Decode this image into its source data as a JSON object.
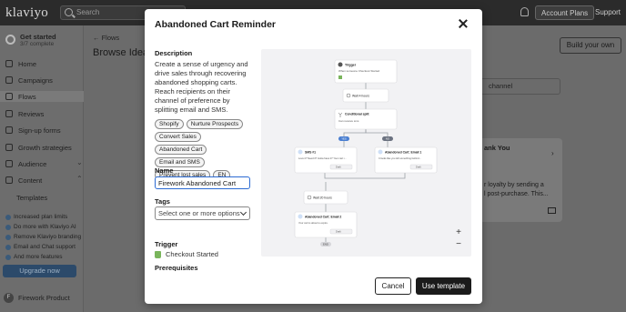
{
  "topbar": {
    "logo": "klaviyo",
    "search_placeholder": "Search",
    "account_plans": "Account Plans",
    "support": "Support"
  },
  "sidebar": {
    "getting_started": {
      "title": "Get started",
      "subtitle": "3/7 complete"
    },
    "items": [
      {
        "label": "Home",
        "icon": "home-icon"
      },
      {
        "label": "Campaigns",
        "icon": "megaphone-icon"
      },
      {
        "label": "Flows",
        "icon": "flow-icon",
        "active": true
      },
      {
        "label": "Reviews",
        "icon": "star-icon"
      },
      {
        "label": "Sign-up forms",
        "icon": "form-icon"
      },
      {
        "label": "Growth strategies",
        "icon": "growth-icon"
      },
      {
        "label": "Audience",
        "icon": "people-icon"
      },
      {
        "label": "Content",
        "icon": "content-icon"
      },
      {
        "label": "Templates",
        "icon": ""
      }
    ],
    "promos": [
      "Increased plan limits",
      "Do more with Klaviyo AI",
      "Remove Klaviyo branding",
      "Email and Chat support",
      "And more features"
    ],
    "upgrade_label": "Upgrade now",
    "user": {
      "initial": "F",
      "name": "Firework Product"
    }
  },
  "main": {
    "breadcrumb": "← Flows",
    "title": "Browse Idea",
    "build_label": "Build your own",
    "channel_placeholder": "channel",
    "card": {
      "title": "ank You",
      "body_line1": "r loyalty by sending a",
      "body_line2": "l post-purchase. This..."
    }
  },
  "modal": {
    "title": "Abandoned Cart Reminder",
    "description_label": "Description",
    "description": "Create a sense of urgency and drive sales through recovering abandoned shopping carts. Reach recipients on their channel of preference by splitting email and SMS.",
    "tags": [
      "Shopify",
      "Nurture Prospects",
      "Convert Sales",
      "Abandoned Cart",
      "Email and SMS",
      "Prevent lost sales",
      "EN"
    ],
    "name_label": "Name",
    "name_value": "Firework Abandoned Cart",
    "tags_label": "Tags",
    "tags_placeholder": "Select one or more options",
    "trigger_label": "Trigger",
    "trigger_value": "Checkout Started",
    "prerequisites_label": "Prerequisites",
    "cancel_label": "Cancel",
    "use_label": "Use template"
  },
  "flow_preview": {
    "trigger_title": "Trigger",
    "trigger_sub": "When someone Checkout Started",
    "wait1": "Wait 4 hours",
    "split_title": "Conditional split",
    "split_sub": "Can receive sms",
    "branch_yes": "YES",
    "branch_no": "NO",
    "sms_title": "SMS #1",
    "sms_body": "Love it? Need it? Gotta have it? Your cart i...",
    "email1_title": "Abandoned Cart: Email 1",
    "email1_body": "It looks like you left something behind...",
    "wait2": "Wait 20 hours",
    "email2_title": "Abandoned Cart: Email 2",
    "email2_body": "Your cart is about to expire.",
    "draft": "Draft",
    "end": "END"
  }
}
